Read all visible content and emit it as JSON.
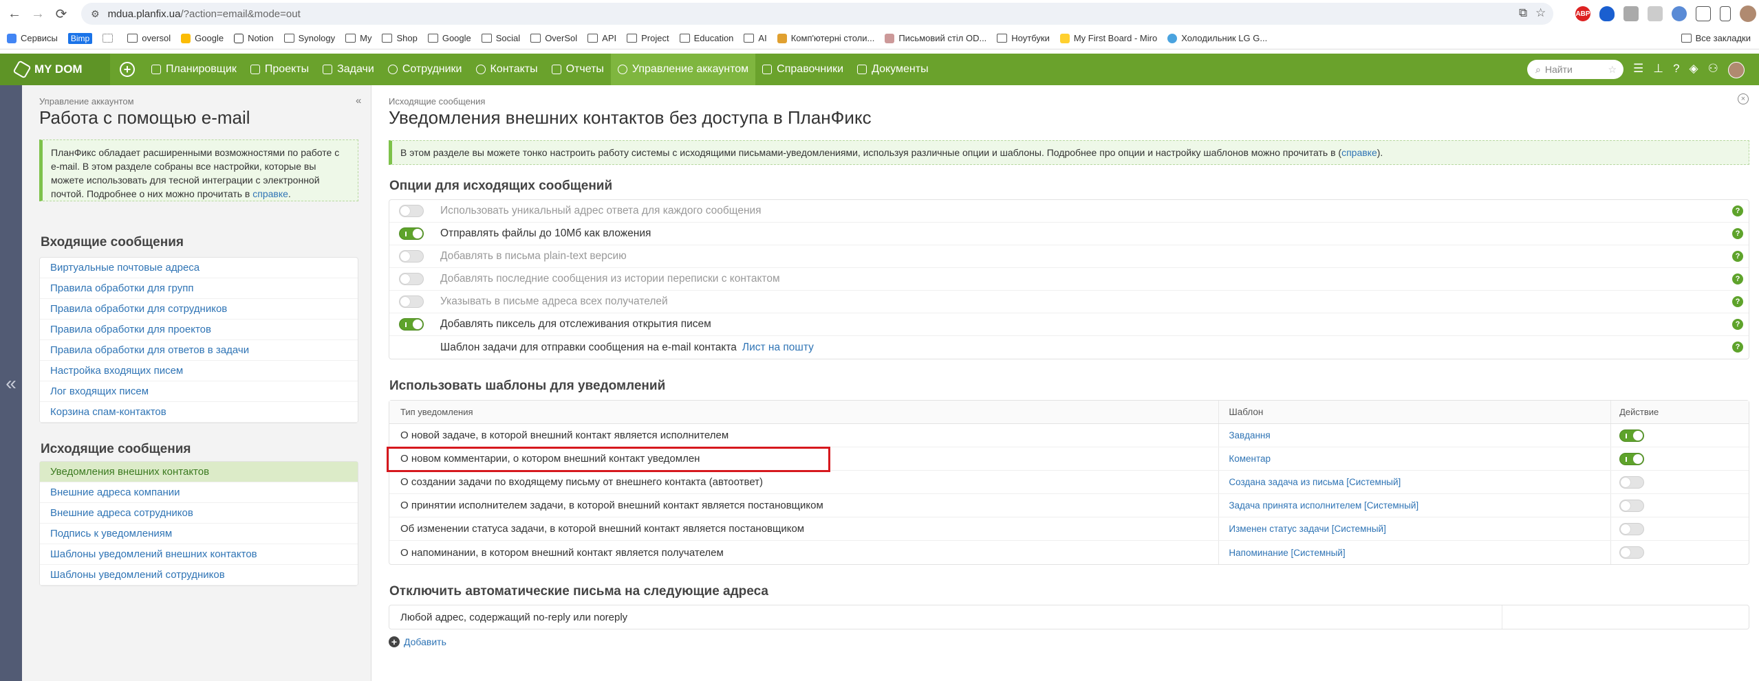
{
  "browser": {
    "url_host": "mdua.planfix.ua",
    "url_path": "/?action=email&mode=out",
    "bookmarks": [
      "Сервисы",
      "Bimp",
      "",
      "oversol",
      "Google",
      "Notion",
      "Synology",
      "My",
      "Shop",
      "Google",
      "Social",
      "OverSol",
      "API",
      "Project",
      "Education",
      "AI",
      "Комп'ютерні столи...",
      "Письмовий стіл OD...",
      "Ноутбуки",
      "My First Board - Miro",
      "Холодильник LG G..."
    ],
    "all_bookmarks": "Все закладки"
  },
  "topnav": {
    "logo": "MY DOM",
    "items": [
      "Планировщик",
      "Проекты",
      "Задачи",
      "Сотрудники",
      "Контакты",
      "Отчеты",
      "Управление аккаунтом",
      "Справочники",
      "Документы"
    ],
    "active_index": 6,
    "search_placeholder": "Найти"
  },
  "sidebar": {
    "breadcrumb": "Управление аккаунтом",
    "title": "Работа с помощью e-mail",
    "info_text": "ПланФикс обладает расширенными возможностями по работе с e-mail. В этом разделе собраны все настройки, которые вы можете использовать для тесной интеграции с электронной почтой. Подробнее о них можно прочитать в ",
    "info_link": "справке",
    "info_end": ".",
    "incoming_header": "Входящие сообщения",
    "incoming": [
      "Виртуальные почтовые адреса",
      "Правила обработки для групп",
      "Правила обработки для сотрудников",
      "Правила обработки для проектов",
      "Правила обработки для ответов в задачи",
      "Настройка входящих писем",
      "Лог входящих писем",
      "Корзина спам-контактов"
    ],
    "outgoing_header": "Исходящие сообщения",
    "outgoing": [
      "Уведомления внешних контактов",
      "Внешние адреса компании",
      "Внешние адреса сотрудников",
      "Подпись к уведомлениям",
      "Шаблоны уведомлений внешних контактов",
      "Шаблоны уведомлений сотрудников"
    ],
    "outgoing_selected": 0
  },
  "main": {
    "breadcrumb": "Исходящие сообщения",
    "title": "Уведомления внешних контактов без доступа в ПланФикс",
    "info_text": "В этом разделе вы можете тонко настроить работу системы с исходящими письмами-уведомлениями, используя различные опции и шаблоны. Подробнее про опции и настройку шаблонов можно прочитать в (",
    "info_link": "справке",
    "info_end": ").",
    "options_header": "Опции для исходящих сообщений",
    "options": [
      {
        "label": "Использовать уникальный адрес ответа для каждого сообщения",
        "on": false
      },
      {
        "label": "Отправлять файлы до 10Мб как вложения",
        "on": true
      },
      {
        "label": "Добавлять в письма plain-text версию",
        "on": false
      },
      {
        "label": "Добавлять последние сообщения из истории переписки с контактом",
        "on": false
      },
      {
        "label": "Указывать в письме адреса всех получателей",
        "on": false
      },
      {
        "label": "Добавлять пиксель для отслеживания открытия писем",
        "on": true
      }
    ],
    "template_row_label": "Шаблон задачи для отправки сообщения на e-mail контакта",
    "template_row_link": "Лист на пошту",
    "templates_header": "Использовать шаблоны для уведомлений",
    "table_headers": [
      "Тип уведомления",
      "Шаблон",
      "Действие"
    ],
    "rows": [
      {
        "type": "О новой задаче, в которой внешний контакт является исполнителем",
        "template": "Завдання",
        "on": true
      },
      {
        "type": "О новом комментарии, о котором внешний контакт уведомлен",
        "template": "Коментар",
        "on": true
      },
      {
        "type": "О создании задачи по входящему письму от внешнего контакта (автоответ)",
        "template": "Создана задача из письма [Системный]",
        "on": false
      },
      {
        "type": "О принятии исполнителем задачи, в которой внешний контакт является постановщиком",
        "template": "Задача принята исполнителем [Системный]",
        "on": false
      },
      {
        "type": "Об изменении статуса задачи, в которой внешний контакт является постановщиком",
        "template": "Изменен статус задачи [Системный]",
        "on": false
      },
      {
        "type": "О напоминании, в котором внешний контакт является получателем",
        "template": "Напоминание [Системный]",
        "on": false
      }
    ],
    "disable_header": "Отключить автоматические письма на следующие адреса",
    "disable_rows": [
      "Любой адрес, содержащий no-reply или noreply"
    ],
    "add_label": "Добавить"
  },
  "colors": {
    "brand_green": "#6aa22c",
    "toggle_on": "#5ea32b",
    "link": "#2f74b5",
    "highlight": "#d6181e"
  }
}
